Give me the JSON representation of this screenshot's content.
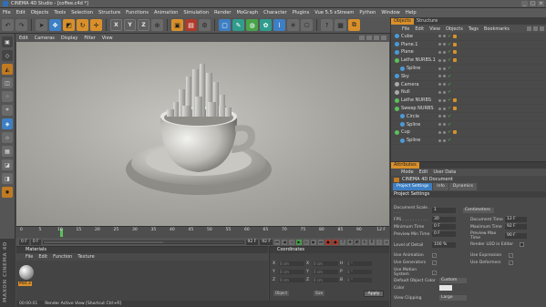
{
  "window": {
    "title": "CINEMA 4D Studio - [coffee.c4d *]"
  },
  "menu": [
    "File",
    "Edit",
    "Objects",
    "Tools",
    "Selection",
    "Structure",
    "Functions",
    "Animation",
    "Simulation",
    "Render",
    "MoGraph",
    "Character",
    "Plugins",
    "Vue 5.5 xStream",
    "Python",
    "Window",
    "Help"
  ],
  "toolbar": {
    "axes": [
      "X",
      "Y",
      "Z"
    ]
  },
  "viewport": {
    "menu": [
      "Edit",
      "Cameras",
      "Display",
      "Filter",
      "View"
    ]
  },
  "timeline": {
    "ticks": [
      "0",
      "5",
      "10",
      "15",
      "20",
      "25",
      "30",
      "35",
      "40",
      "45",
      "50",
      "55",
      "60",
      "65",
      "70",
      "75",
      "80",
      "85",
      "90"
    ],
    "current": "12",
    "end_label": "12 F"
  },
  "playbar": {
    "start": "0 F",
    "min": "0 F",
    "max": "92 F",
    "end": "92 F"
  },
  "materials": {
    "title": "Materials",
    "menu": [
      "File",
      "Edit",
      "Function",
      "Texture"
    ],
    "item": "Mat.3"
  },
  "coords": {
    "title": "Coordinates",
    "rows": [
      {
        "a": "X",
        "av": "0 cm",
        "b": "X",
        "bv": "0 cm",
        "c": "H",
        "cv": "0 °"
      },
      {
        "a": "Y",
        "av": "0 cm",
        "b": "Y",
        "bv": "0 cm",
        "c": "P",
        "cv": "0 °"
      },
      {
        "a": "Z",
        "av": "0 cm",
        "b": "Z",
        "bv": "0 cm",
        "c": "B",
        "cv": "0 °"
      }
    ],
    "dd1": "Object",
    "dd2": "Size",
    "apply": "Apply"
  },
  "status": {
    "time": "00:00:01",
    "text": "Render Active View [Shortcut Ctrl+R]"
  },
  "objects": {
    "tabs": [
      "Objects",
      "Structure"
    ],
    "menu": [
      "File",
      "Edit",
      "View",
      "Objects",
      "Tags",
      "Bookmarks"
    ],
    "items": [
      {
        "label": "Cube",
        "indent": 0,
        "color": "#4a9bd6",
        "tag": true
      },
      {
        "label": "Plane.1",
        "indent": 0,
        "color": "#4a9bd6",
        "tag": true
      },
      {
        "label": "Plane",
        "indent": 0,
        "color": "#4a9bd6",
        "tag": true
      },
      {
        "label": "Lathe NURBS.1",
        "indent": 0,
        "color": "#5cc05c",
        "tag": true
      },
      {
        "label": "Spline",
        "indent": 1,
        "color": "#4a9bd6",
        "tag": false
      },
      {
        "label": "Sky",
        "indent": 0,
        "color": "#4a9bd6",
        "tag": false
      },
      {
        "label": "Camera",
        "indent": 0,
        "color": "#aaaaaa",
        "tag": false
      },
      {
        "label": "Null",
        "indent": 0,
        "color": "#aaaaaa",
        "tag": false
      },
      {
        "label": "Lathe NURBS",
        "indent": 0,
        "color": "#5cc05c",
        "tag": true
      },
      {
        "label": "Sweep NURBS",
        "indent": 0,
        "color": "#5cc05c",
        "tag": true
      },
      {
        "label": "Circle",
        "indent": 1,
        "color": "#4a9bd6",
        "tag": false
      },
      {
        "label": "Spline",
        "indent": 1,
        "color": "#4a9bd6",
        "tag": false
      },
      {
        "label": "Cup",
        "indent": 0,
        "color": "#5cc05c",
        "tag": true
      },
      {
        "label": "Spline",
        "indent": 1,
        "color": "#4a9bd6",
        "tag": false
      }
    ]
  },
  "attributes": {
    "tab": "Attributes",
    "menu": [
      "Mode",
      "Edit",
      "User Data"
    ],
    "doc": "CINEMA 4D Document",
    "subtabs": [
      "Project Settings",
      "Info",
      "Dynamics"
    ],
    "section": "Project Settings",
    "doc_scale_label": "Document Scale . . . .",
    "doc_scale_value": "1",
    "doc_scale_unit": "Centimeters",
    "fps_label": "FPS . . . . . . . . . .",
    "fps": "30",
    "doc_time_label": "Document Time",
    "doc_time": "12 F",
    "min_time_label": "Minimum Time",
    "min_time": "0 F",
    "max_time_label": "Maximum Time",
    "max_time": "92 F",
    "prev_min_label": "Preview Min Time",
    "prev_min": "0 F",
    "prev_max_label": "Preview Max Time",
    "prev_max": "90 F",
    "lod_label": "Level of Detail",
    "lod": "100 %",
    "render_lod_label": "Render LOD in Editor",
    "use_anim": "Use Animation",
    "use_expr": "Use Expression",
    "use_gen": "Use Generators",
    "use_def": "Use Deformers",
    "use_motion": "Use Motion System",
    "default_color_label": "Default Object Color",
    "default_color": "Custom",
    "color_label": "Color",
    "view_clip_label": "View Clipping",
    "view_clip": "Large"
  }
}
